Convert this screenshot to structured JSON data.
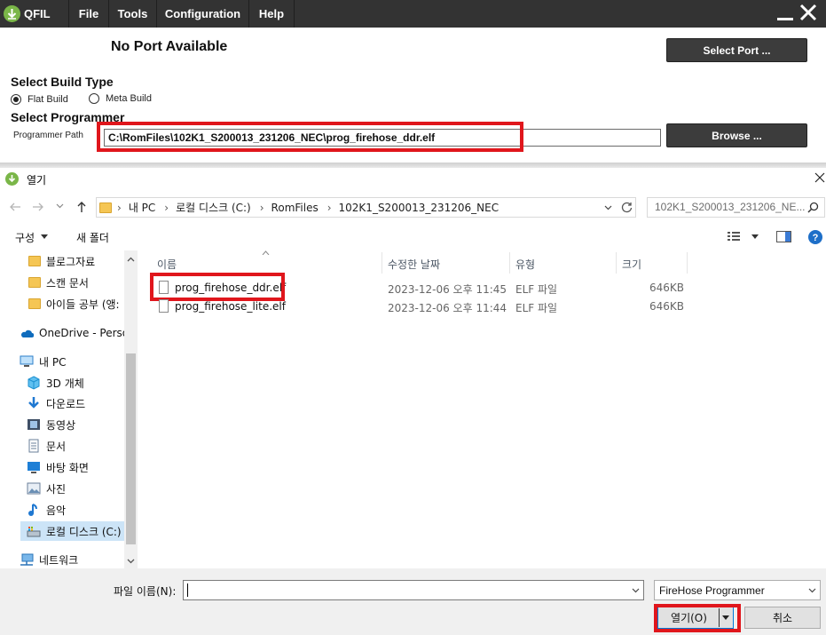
{
  "qfil": {
    "app_name": "QFIL",
    "menu": [
      "File",
      "Tools",
      "Configuration",
      "Help"
    ],
    "port_status": "No Port Available",
    "select_port_label": "Select Port ...",
    "build_type_title": "Select Build Type",
    "build_options": [
      {
        "label": "Flat Build",
        "selected": true
      },
      {
        "label": "Meta Build",
        "selected": false
      }
    ],
    "programmer_title": "Select Programmer",
    "programmer_path_label": "Programmer Path",
    "programmer_path_value": "C:\\RomFiles\\102K1_S200013_231206_NEC\\prog_firehose_ddr.elf",
    "browse_label": "Browse ...",
    "highlight_color": "#e0161c",
    "menubar_color": "#333333"
  },
  "dialog": {
    "title": "열기",
    "breadcrumb": [
      "내 PC",
      "로컬 디스크 (C:)",
      "RomFiles",
      "102K1_S200013_231206_NEC"
    ],
    "search_placeholder": "102K1_S200013_231206_NE...",
    "toolbar": {
      "organize": "구성",
      "new_folder": "새 폴더"
    },
    "nav_items": [
      {
        "label": "블로그자료",
        "icon": "folder-icon"
      },
      {
        "label": "스캔 문서",
        "icon": "folder-icon"
      },
      {
        "label": "아이들 공부 (앵:",
        "icon": "folder-icon"
      },
      {
        "label": "OneDrive - Persor",
        "icon": "cloud-icon"
      },
      {
        "label": "내 PC",
        "icon": "pc-icon"
      },
      {
        "label": "3D 개체",
        "icon": "cube-icon"
      },
      {
        "label": "다운로드",
        "icon": "download-icon"
      },
      {
        "label": "동영상",
        "icon": "video-icon"
      },
      {
        "label": "문서",
        "icon": "document-icon"
      },
      {
        "label": "바탕 화면",
        "icon": "desktop-icon"
      },
      {
        "label": "사진",
        "icon": "picture-icon"
      },
      {
        "label": "음악",
        "icon": "music-icon"
      },
      {
        "label": "로컬 디스크 (C:)",
        "icon": "drive-icon",
        "selected": true
      },
      {
        "label": "네트워크",
        "icon": "network-icon"
      }
    ],
    "columns": [
      "이름",
      "수정한 날짜",
      "유형",
      "크기"
    ],
    "files": [
      {
        "name": "prog_firehose_ddr.elf",
        "modified": "2023-12-06 오후 11:45",
        "type": "ELF 파일",
        "size": "646KB"
      },
      {
        "name": "prog_firehose_lite.elf",
        "modified": "2023-12-06 오후 11:44",
        "type": "ELF 파일",
        "size": "646KB"
      }
    ],
    "filename_label": "파일 이름(N):",
    "filename_value": "",
    "filter_value": "FireHose Programmer",
    "open_label": "열기(O)",
    "cancel_label": "취소"
  }
}
